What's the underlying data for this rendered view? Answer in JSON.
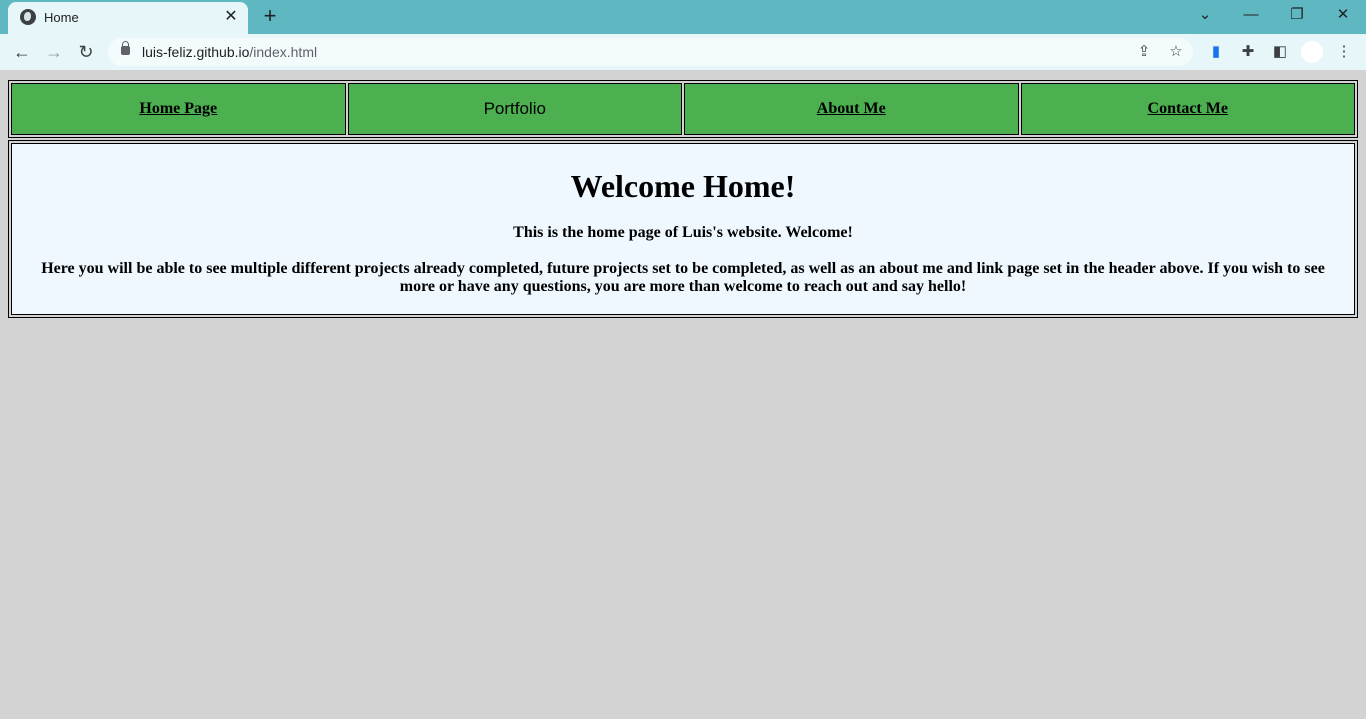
{
  "browser": {
    "tab_title": "Home",
    "url_host": "luis-feliz.github.io",
    "url_path": "/index.html",
    "icons": {
      "favicon": "globe-icon",
      "close": "close-icon",
      "new_tab": "plus-icon",
      "back": "arrow-left-icon",
      "forward": "arrow-right-icon",
      "reload": "reload-icon",
      "lock": "lock-icon",
      "share": "share-icon",
      "bookmark": "star-icon",
      "extensions": "puzzle-icon",
      "side_panel": "side-panel-icon",
      "menu": "kebab-menu-icon"
    },
    "colors": {
      "tabbar": "#5fb8c1",
      "toolbar": "#e7f6f8"
    }
  },
  "nav": {
    "items": [
      {
        "label": "Home Page",
        "link": true
      },
      {
        "label": "Portfolio",
        "link": false
      },
      {
        "label": "About Me",
        "link": true
      },
      {
        "label": "Contact Me",
        "link": true
      }
    ],
    "color": "#4caf50"
  },
  "main": {
    "heading": "Welcome Home!",
    "intro": "This is the home page of Luis's website. Welcome!",
    "description": "Here you will be able to see multiple different projects already completed, future projects set to be completed, as well as an about me and link page set in the header above. If you wish to see more or have any questions, you are more than welcome to reach out and say hello!",
    "background": "#eff8ff"
  },
  "page_background": "#d3d3d3"
}
